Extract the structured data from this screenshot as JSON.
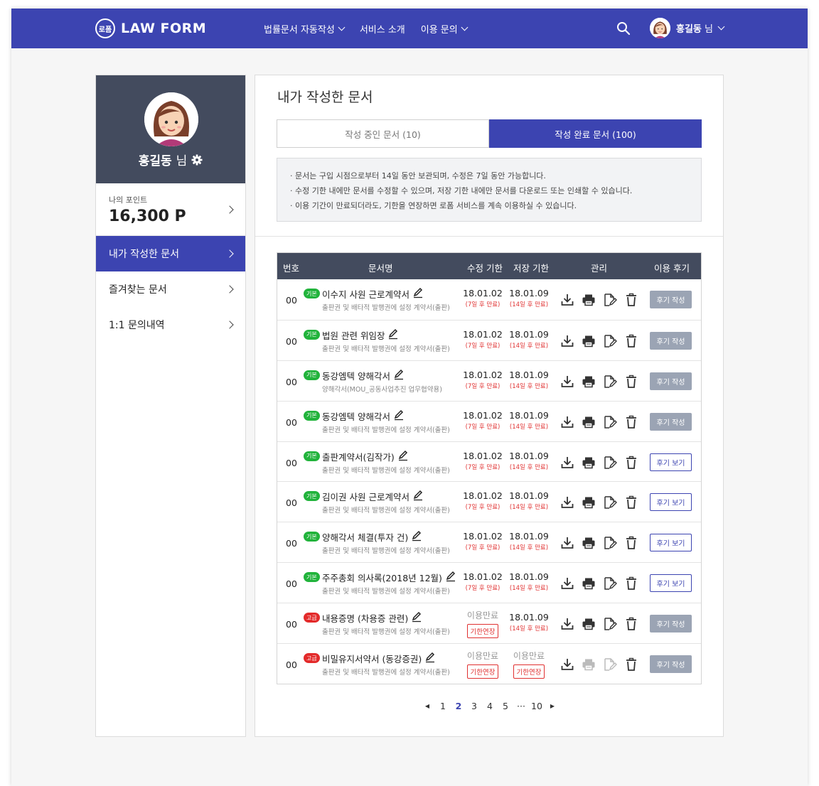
{
  "header": {
    "logo_mark": "로폼",
    "logo_text": "LAW FORM",
    "nav": [
      "법률문서 자동작성",
      "서비스 소개",
      "이용 문의"
    ],
    "user_name": "홍길동",
    "user_suffix": "님"
  },
  "sidebar": {
    "profile_name": "홍길동",
    "profile_suffix": "님",
    "points_label": "나의 포인트",
    "points_value": "16,300 P",
    "menu": [
      "내가 작성한 문서",
      "즐겨찾는 문서",
      "1:1 문의내역"
    ]
  },
  "main": {
    "title": "내가 작성한 문서",
    "tabs": [
      "작성 중인 문서 (10)",
      "작성 완료 문서 (100)"
    ],
    "notice": [
      "· 문서는 구입 시점으로부터 14일 동안 보관되며, 수정은 7일 동안 가능합니다.",
      "· 수정 기한 내에만 문서를 수정할 수 있으며, 저장 기한 내에만 문서를 다운로드 또는 인쇄할 수 있습니다.",
      "· 이용 기간이 만료되더라도, 기한을 연장하면 로폼 서비스를 계속 이용하실 수 있습니다."
    ],
    "columns": [
      "번호",
      "문서명",
      "수정 기한",
      "저장 기한",
      "관리",
      "이용 후기"
    ],
    "rows": [
      {
        "no": "00",
        "badge": "기본",
        "title": "이수지 사원 근로계약서",
        "sub": "출판권 및 배타적 발행권에 설정 계약서(출판)",
        "edit_date": "18.01.02",
        "edit_note": "(7일 후 만료)",
        "save_date": "18.01.09",
        "save_note": "(14일 후 만료)",
        "review": "후기 작성"
      },
      {
        "no": "00",
        "badge": "기본",
        "title": "법원 관련 위임장",
        "sub": "출판권 및 배타적 발행권에 설정 계약서(출판)",
        "edit_date": "18.01.02",
        "edit_note": "(7일 후 만료)",
        "save_date": "18.01.09",
        "save_note": "(14일 후 만료)",
        "review": "후기 작성"
      },
      {
        "no": "00",
        "badge": "기본",
        "title": "동강엠텍 양해각서",
        "sub": "양해각서(MOU_공동사업추진 업무협약용)",
        "edit_date": "18.01.02",
        "edit_note": "(7일 후 만료)",
        "save_date": "18.01.09",
        "save_note": "(14일 후 만료)",
        "review": "후기 작성"
      },
      {
        "no": "00",
        "badge": "기본",
        "title": "동강엠텍 양해각서",
        "sub": "출판권 및 배타적 발행권에 설정 계약서(출판)",
        "edit_date": "18.01.02",
        "edit_note": "(7일 후 만료)",
        "save_date": "18.01.09",
        "save_note": "(14일 후 만료)",
        "review": "후기 작성"
      },
      {
        "no": "00",
        "badge": "기본",
        "title": "출판계약서(김작가)",
        "sub": "출판권 및 배타적 발행권에 설정 계약서(출판)",
        "edit_date": "18.01.02",
        "edit_note": "(7일 후 만료)",
        "save_date": "18.01.09",
        "save_note": "(14일 후 만료)",
        "review": "후기 보기"
      },
      {
        "no": "00",
        "badge": "기본",
        "title": "김이권 사원 근로계약서",
        "sub": "출판권 및 배타적 발행권에 설정 계약서(출판)",
        "edit_date": "18.01.02",
        "edit_note": "(7일 후 만료)",
        "save_date": "18.01.09",
        "save_note": "(14일 후 만료)",
        "review": "후기 보기"
      },
      {
        "no": "00",
        "badge": "기본",
        "title": "양해각서 체결(투자 건)",
        "sub": "출판권 및 배타적 발행권에 설정 계약서(출판)",
        "edit_date": "18.01.02",
        "edit_note": "(7일 후 만료)",
        "save_date": "18.01.09",
        "save_note": "(14일 후 만료)",
        "review": "후기 보기"
      },
      {
        "no": "00",
        "badge": "기본",
        "title": "주주총회 의사록(2018년 12월)",
        "sub": "출판권 및 배타적 발행권에 설정 계약서(출판)",
        "edit_date": "18.01.02",
        "edit_note": "(7일 후 만료)",
        "save_date": "18.01.09",
        "save_note": "(14일 후 만료)",
        "review": "후기 보기"
      },
      {
        "no": "00",
        "badge": "고급",
        "title": "내용증명 (차용증 관련)",
        "sub": "출판권 및 배타적 발행권에 설정 계약서(출판)",
        "edit_expired": "이용만료",
        "edit_extend": "기한연장",
        "save_date": "18.01.09",
        "save_note": "(14일 후 만료)",
        "review": "후기 작성"
      },
      {
        "no": "00",
        "badge": "고급",
        "title": "비밀유지서약서 (동강증권)",
        "sub": "출판권 및 배타적 발행권에 설정 계약서(출판)",
        "edit_expired": "이용만료",
        "edit_extend": "기한연장",
        "save_expired": "이용만료",
        "save_extend": "기한연장",
        "review": "후기 작성"
      }
    ],
    "pagination": [
      "1",
      "2",
      "3",
      "4",
      "5",
      "···",
      "10"
    ],
    "current_page": "2"
  },
  "colors": {
    "brand": "#3c44b1",
    "dark": "#434b5e",
    "basic_badge": "#21b33b",
    "adv_badge": "#e32a2a",
    "expire_red": "#e03030"
  },
  "icons": [
    "search-icon",
    "chevron-down-icon",
    "gear-icon",
    "chevron-right-icon",
    "pencil-icon",
    "download-icon",
    "print-icon",
    "edit-document-icon",
    "trash-icon"
  ]
}
